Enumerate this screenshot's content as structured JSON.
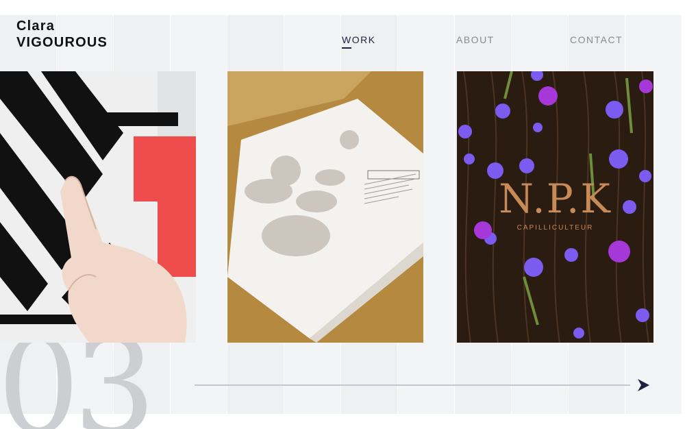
{
  "brand": {
    "first_name": "Clara",
    "last_name": "VIGOUROUS"
  },
  "nav": {
    "items": [
      {
        "label": "WORK",
        "active": true
      },
      {
        "label": "ABOUT",
        "active": false
      },
      {
        "label": "CONTACT",
        "active": false
      }
    ]
  },
  "projects": [
    {
      "name": "graphic-wall"
    },
    {
      "name": "herbarium-book"
    },
    {
      "name": "npk-poster",
      "title": "N.P.K",
      "subtitle": "CAPILLICULTEUR"
    }
  ],
  "slide_number": "03",
  "next_icon": "arrow-right-icon",
  "colors": {
    "accent": "#1e2140",
    "poster_text": "#c88a57",
    "red": "#ef4d4d",
    "gold": "#b5893f"
  }
}
